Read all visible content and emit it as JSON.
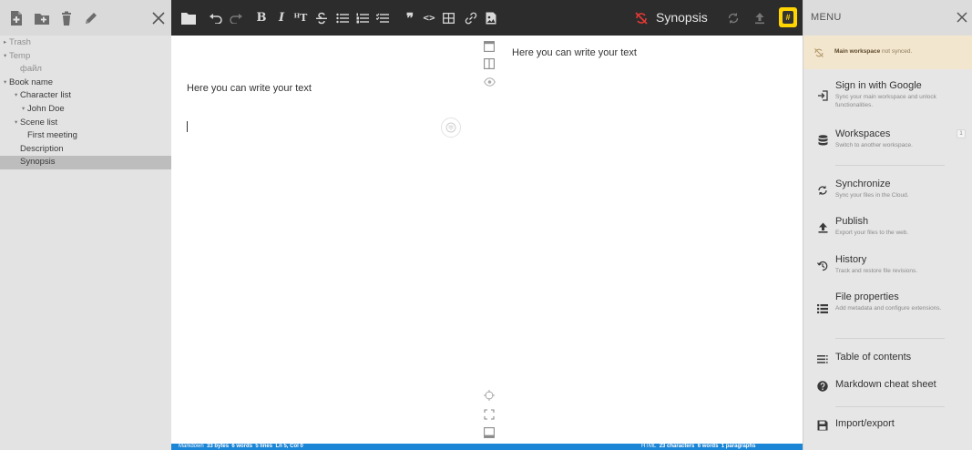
{
  "app": {
    "document_title": "Synopsis"
  },
  "explorer": {
    "close_label": "×",
    "tree": [
      {
        "label": "Trash",
        "caret": "▸",
        "level": 0,
        "style": "muted"
      },
      {
        "label": "Temp",
        "caret": "▾",
        "level": 0,
        "style": "muted"
      },
      {
        "label": "файл",
        "caret": "",
        "level": 1,
        "style": "muted"
      },
      {
        "label": "Book name",
        "caret": "▾",
        "level": 0,
        "style": ""
      },
      {
        "label": "Character list",
        "caret": "▾",
        "level": 1,
        "style": ""
      },
      {
        "label": "John Doe",
        "caret": "▾",
        "level": 2,
        "style": ""
      },
      {
        "label": "Scene list",
        "caret": "▾",
        "level": 1,
        "style": ""
      },
      {
        "label": "First meeting",
        "caret": "",
        "level": 2,
        "style": ""
      },
      {
        "label": "Description",
        "caret": "",
        "level": 1,
        "style": ""
      },
      {
        "label": "Synopsis",
        "caret": "",
        "level": 1,
        "style": "selected"
      }
    ]
  },
  "toolbar": {
    "bold": "B",
    "italic": "I",
    "heading": "ᴴT",
    "quote": "❞",
    "code": "<>"
  },
  "editor": {
    "content": "Here you can write your text"
  },
  "preview": {
    "content": "Here you can write your text"
  },
  "status": {
    "markdown_label": "Markdown",
    "bytes": "33 bytes",
    "words": "6 words",
    "lines": "5 lines",
    "position": "Ln 5, Col 0",
    "html_label": "HTML",
    "characters": "23 characters",
    "html_words": "6 words",
    "paragraphs": "1 paragraphs"
  },
  "menu": {
    "title": "MENU",
    "close_label": "×",
    "notice_bold": "Main workspace",
    "notice_rest": " not synced.",
    "items": [
      {
        "title": "Sign in with Google",
        "desc": "Sync your main workspace and unlock functionalities."
      },
      {
        "title": "Workspaces",
        "desc": "Switch to another workspace.",
        "badge": "1"
      },
      {
        "title": "Synchronize",
        "desc": "Sync your files in the Cloud."
      },
      {
        "title": "Publish",
        "desc": "Export your files to the web."
      },
      {
        "title": "History",
        "desc": "Track and restore file revisions."
      },
      {
        "title": "File properties",
        "desc": "Add metadata and configure extensions."
      },
      {
        "title": "Table of contents",
        "desc": ""
      },
      {
        "title": "Markdown cheat sheet",
        "desc": ""
      },
      {
        "title": "Import/export",
        "desc": ""
      }
    ]
  },
  "icons": {
    "explorer": [
      "new-file-icon",
      "new-folder-icon",
      "delete-icon",
      "rename-icon",
      "close-icon"
    ],
    "toolbar": [
      "folder-icon",
      "undo-icon",
      "redo-icon",
      "bold-icon",
      "italic-icon",
      "heading-icon",
      "strikethrough-icon",
      "unordered-list-icon",
      "ordered-list-icon",
      "checklist-icon",
      "quote-icon",
      "code-icon",
      "table-icon",
      "link-icon",
      "image-icon",
      "sync-off-icon",
      "sync-icon",
      "publish-icon",
      "help-icon"
    ]
  },
  "colors": {
    "toolbar_bg": "#2c2c2c",
    "status_bg": "#1b85d6",
    "notice_bg": "#f3e6cf",
    "warning_red": "#e53935",
    "help_yellow": "#ffd400",
    "selected_row": "#bdbdbd"
  }
}
